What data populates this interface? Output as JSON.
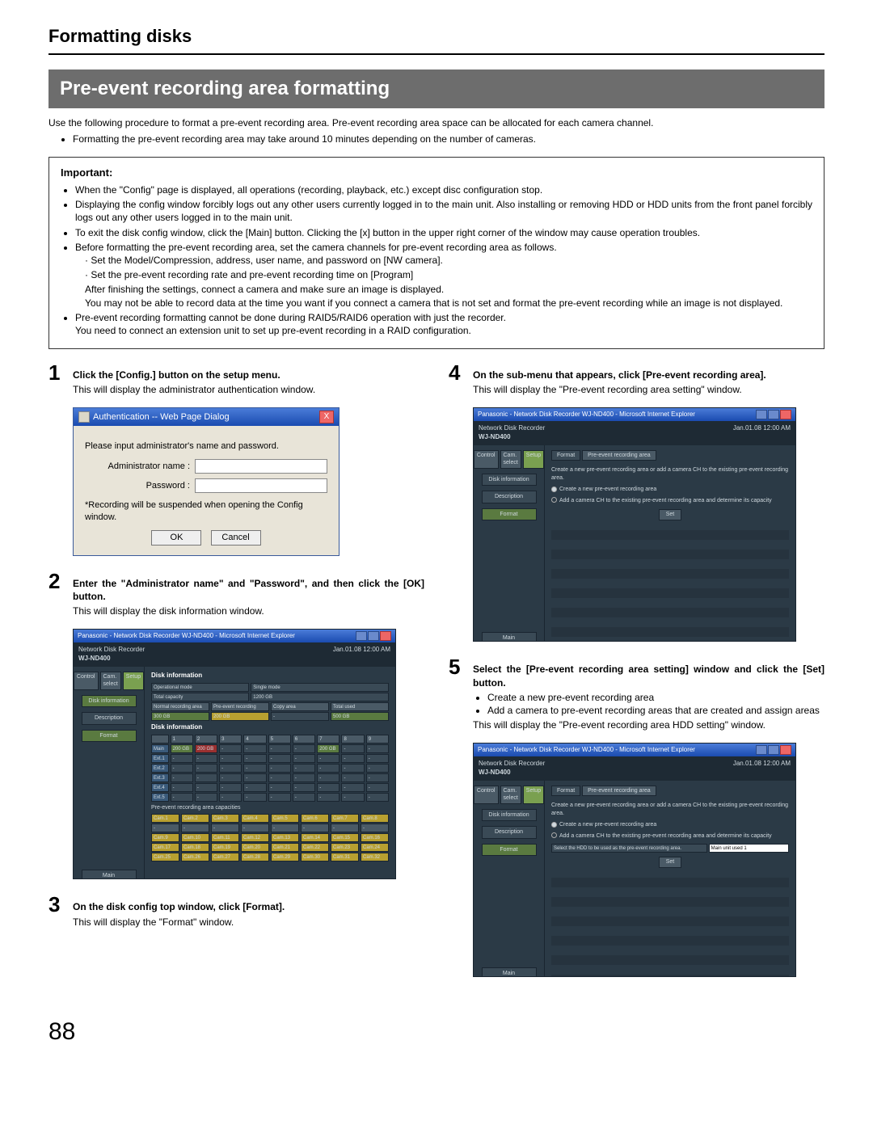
{
  "page_title": "Formatting disks",
  "section_heading": "Pre-event recording area formatting",
  "intro": "Use the following procedure to format a pre-event recording area. Pre-event recording area space can be allocated for each camera channel.",
  "intro_bullet": "Formatting the pre-event recording area may take around 10 minutes depending on the number of cameras.",
  "important": {
    "label": "Important:",
    "items": [
      "When the \"Config\" page is displayed, all operations (recording, playback, etc.) except disc configuration stop.",
      "Displaying the config window forcibly logs out any other users currently logged in to the main unit. Also installing or removing HDD or HDD units from the front panel forcibly logs out any other users logged in to the main unit.",
      "To exit the disk config window, click the [Main] button. Clicking the [x] button in the upper right corner of the window may cause operation troubles.",
      "Before formatting the pre-event recording area, set the camera channels for pre-event recording area as follows."
    ],
    "sub": [
      "Set the Model/Compression, address, user name, and password on [NW camera].",
      "Set the pre-event recording rate and pre-event recording time on [Program]"
    ],
    "sub_after": [
      "After finishing the settings, connect a camera and make sure an image is displayed.",
      "You may not be able to record data at the time you want if you connect a camera that is not set and format the pre-event recording while an image is not displayed."
    ],
    "items2": [
      "Pre-event recording formatting cannot be done during RAID5/RAID6 operation with just the recorder.",
      "You need to connect an extension unit to set up pre-event recording in a RAID configuration."
    ]
  },
  "steps": {
    "s1": {
      "n": "1",
      "head": "Click the [Config.] button on the setup menu.",
      "desc": "This will display the administrator authentication window."
    },
    "s2": {
      "n": "2",
      "head": "Enter the \"Administrator name\" and \"Password\", and then click the [OK] button.",
      "desc": "This will display the disk information window."
    },
    "s3": {
      "n": "3",
      "head": "On the disk config top window, click [Format].",
      "desc": "This will display the \"Format\" window."
    },
    "s4": {
      "n": "4",
      "head": "On the sub-menu that appears, click [Pre-event recording area].",
      "desc": "This will display the \"Pre-event recording area setting\" window."
    },
    "s5": {
      "n": "5",
      "head": "Select the [Pre-event recording area setting] window and click the [Set] button.",
      "b1": "Create a new pre-event recording area",
      "b2": "Add a camera to pre-event recording areas that are created and assign areas",
      "desc": "This will display the \"Pre-event recording area HDD setting\" window."
    }
  },
  "dialog": {
    "title": "Authentication -- Web Page Dialog",
    "prompt": "Please input administrator's name and password.",
    "lbl_name": "Administrator name :",
    "lbl_pass": "Password :",
    "note": "*Recording will be suspended when opening the Config window.",
    "ok": "OK",
    "cancel": "Cancel"
  },
  "app_common": {
    "browser_title": "Panasonic - Network Disk Recorder WJ-ND400 - Microsoft Internet Explorer",
    "product": "Network Disk Recorder",
    "model": "WJ-ND400",
    "timestamp": "Jan.01.08  12:00 AM",
    "tabs": {
      "control": "Control",
      "cam_select": "Cam. select",
      "setup": "Setup"
    },
    "side": {
      "disk_info": "Disk information",
      "description": "Description",
      "format": "Format",
      "main": "Main"
    },
    "topmenu": {
      "format": "Format",
      "preevent": "Pre-event recording area"
    }
  },
  "app1": {
    "heading": "Disk information",
    "op_lbl": "Operational mode",
    "op_val": "Single mode",
    "cap_lbl": "Total capacity",
    "cap_val": "1200 GB",
    "cols": [
      "Normal recording area",
      "Pre-event recording area",
      "Copy area",
      "Total used"
    ],
    "row1": [
      "300 GB",
      "200 GB",
      "-",
      "500 GB"
    ],
    "th": "Disk information",
    "hdr": [
      "",
      "1",
      "2",
      "3",
      "4",
      "5",
      "6",
      "7",
      "8",
      "9"
    ],
    "mainrow_lbl": "Main",
    "mainrow": [
      "200 GB Normal",
      "200 GB Pre-evt",
      "-",
      "-",
      "-",
      "-",
      "200 GB Normal",
      "-",
      "-"
    ],
    "ext": [
      "Ext.1",
      "Ext.2",
      "Ext.3",
      "Ext.4",
      "Ext.5"
    ],
    "pre_hd": "Pre-event recording area capacities",
    "cam_row1": [
      "Cam.1",
      "Cam.2",
      "Cam.3",
      "Cam.4",
      "Cam.5",
      "Cam.6",
      "Cam.7",
      "Cam.8"
    ],
    "cam_row2": [
      "Cam.9",
      "Cam.10",
      "Cam.11",
      "Cam.12",
      "Cam.13",
      "Cam.14",
      "Cam.15",
      "Cam.16"
    ],
    "cam_row3": [
      "Cam.17",
      "Cam.18",
      "Cam.19",
      "Cam.20",
      "Cam.21",
      "Cam.22",
      "Cam.23",
      "Cam.24"
    ],
    "cam_row4": [
      "Cam.25",
      "Cam.26",
      "Cam.27",
      "Cam.28",
      "Cam.29",
      "Cam.30",
      "Cam.31",
      "Cam.32"
    ]
  },
  "app2": {
    "msg": "Create a new pre-event recording area or add a camera CH to the existing pre-event recording area.",
    "r1": "Create a new pre-event recording area",
    "r2": "Add a camera CH to the existing pre-event recording area and determine its capacity",
    "set": "Set"
  },
  "app3": {
    "msg": "Create a new pre-event recording area or add a camera CH to the existing pre-event recording area.",
    "r1": "Create a new pre-event recording area",
    "r2": "Add a camera CH to the existing pre-event recording area and determine its capacity",
    "sel_lbl": "Select the HDD to be used as the pre-event recording area.",
    "sel_val": "Main unit used  1",
    "set": "Set"
  },
  "page_number": "88"
}
